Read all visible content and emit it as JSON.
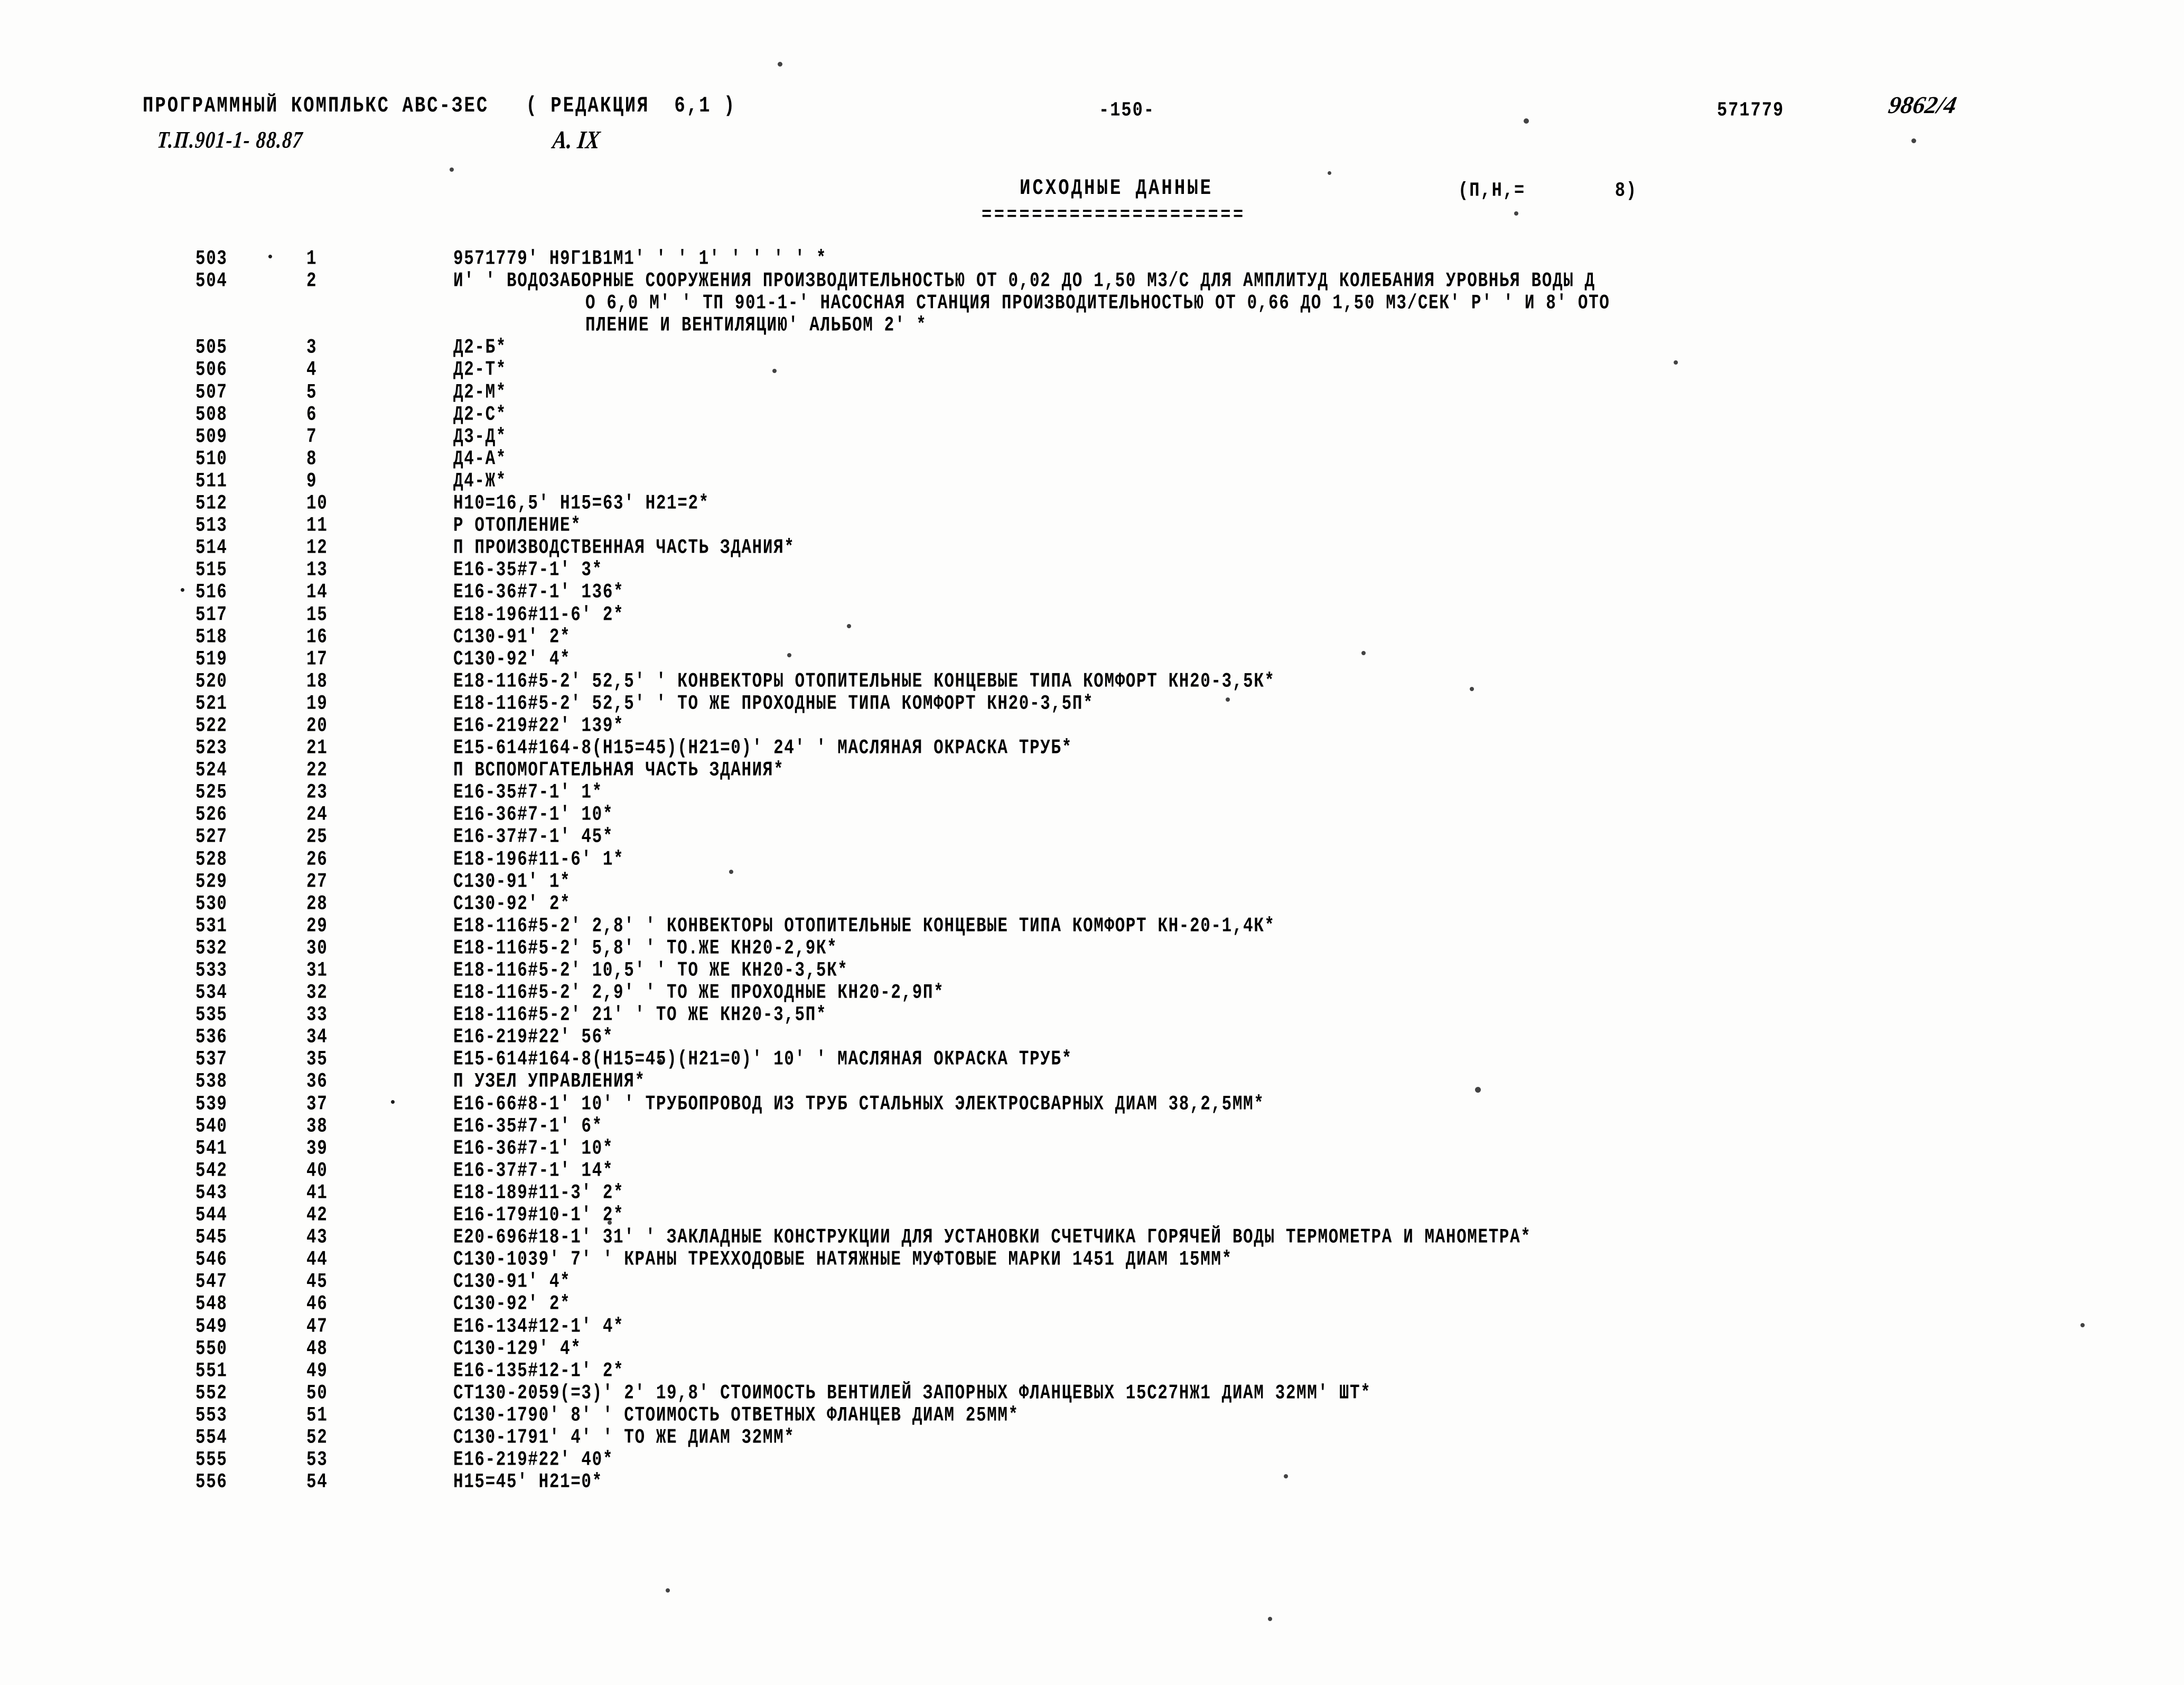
{
  "header": {
    "program_line": "ПРОГРАММНЫЙ КОМПЛЬКС АВС-ЗЕС   ( РЕДАКЦИЯ  6,1 )",
    "project_line": "Т.П.901-1- 88.87",
    "album_mark": "А. IX",
    "page_number": "-150-",
    "doc_code": "571779",
    "stamp": "9862/4"
  },
  "title": {
    "main": "ИСХОДНЫЕ ДАННЫЕ",
    "underline": "=====================",
    "param": "(П,Н,=        8)"
  },
  "listing": {
    "rows": [
      {
        "seq": "503",
        "num": "1",
        "text": "9571779' Н9Г1В1М1' ' ' 1' ' ' ' ' *",
        "dot_after_seq": true
      },
      {
        "seq": "504",
        "num": "2",
        "text": "И' ' ВОДОЗАБОРНЫЕ СООРУЖЕНИЯ ПРОИЗВОДИТЕЛЬНОСТЬЮ ОТ 0,02 ДО 1,50 М3/С ДЛЯ АМПЛИТУД КОЛЕБАНИЯ УРОВНЬЯ ВОДЫ Д"
      },
      {
        "seq": "",
        "num": "",
        "cont": "О 6,0 М' ' ТП 901-1-' НАСОСНАЯ СТАНЦИЯ ПРОИЗВОДИТЕЛЬНОСТЬЮ ОТ 0,66 ДО 1,50 М3/СЕК' Р' ' И 8' ОТО"
      },
      {
        "seq": "",
        "num": "",
        "cont": "ПЛЕНИЕ И ВЕНТИЛЯЦИЮ' АЛЬБОМ 2' *"
      },
      {
        "seq": "505",
        "num": "3",
        "text": "Д2-Б*"
      },
      {
        "seq": "506",
        "num": "4",
        "text": "Д2-Т*"
      },
      {
        "seq": "507",
        "num": "5",
        "text": "Д2-М*"
      },
      {
        "seq": "508",
        "num": "6",
        "text": "Д2-С*"
      },
      {
        "seq": "509",
        "num": "7",
        "text": "Д3-Д*"
      },
      {
        "seq": "510",
        "num": "8",
        "text": "Д4-А*"
      },
      {
        "seq": "511",
        "num": "9",
        "text": "Д4-Ж*"
      },
      {
        "seq": "512",
        "num": "10",
        "text": "Н10=16,5' Н15=63' Н21=2*"
      },
      {
        "seq": "513",
        "num": "11",
        "text": "Р ОТОПЛЕНИЕ*"
      },
      {
        "seq": "514",
        "num": "12",
        "text": "П ПРОИЗВОДСТВЕННАЯ ЧАСТЬ ЗДАНИЯ*"
      },
      {
        "seq": "515",
        "num": "13",
        "text": "Е16-35#7-1' 3*"
      },
      {
        "seq": "516",
        "num": "14",
        "text": "Е16-36#7-1' 136*",
        "dot_before_seq": true
      },
      {
        "seq": "517",
        "num": "15",
        "text": "Е18-196#11-6' 2*"
      },
      {
        "seq": "518",
        "num": "16",
        "text": "С130-91' 2*"
      },
      {
        "seq": "519",
        "num": "17",
        "text": "С130-92' 4*"
      },
      {
        "seq": "520",
        "num": "18",
        "text": "Е18-116#5-2' 52,5' ' КОНВЕКТОРЫ ОТОПИТЕЛЬНЫЕ КОНЦЕВЫЕ ТИПА КОМФОРТ КН20-3,5К*"
      },
      {
        "seq": "521",
        "num": "19",
        "text": "Е18-116#5-2' 52,5' ' ТО ЖЕ ПРОХОДНЫЕ ТИПА КОМФОРТ КН20-3,5П*"
      },
      {
        "seq": "522",
        "num": "20",
        "text": "Е16-219#22' 139*"
      },
      {
        "seq": "523",
        "num": "21",
        "text": "Е15-614#164-8(Н15=45)(Н21=0)' 24' ' МАСЛЯНАЯ ОКРАСКА ТРУБ*"
      },
      {
        "seq": "524",
        "num": "22",
        "text": "П ВСПОМОГАТЕЛЬНАЯ ЧАСТЬ ЗДАНИЯ*"
      },
      {
        "seq": "525",
        "num": "23",
        "text": "Е16-35#7-1' 1*"
      },
      {
        "seq": "526",
        "num": "24",
        "text": "Е16-36#7-1' 10*"
      },
      {
        "seq": "527",
        "num": "25",
        "text": "Е16-37#7-1' 45*"
      },
      {
        "seq": "528",
        "num": "26",
        "text": "Е18-196#11-6' 1*"
      },
      {
        "seq": "529",
        "num": "27",
        "text": "С130-91' 1*"
      },
      {
        "seq": "530",
        "num": "28",
        "text": "С130-92' 2*"
      },
      {
        "seq": "531",
        "num": "29",
        "text": "Е18-116#5-2' 2,8' ' КОНВЕКТОРЫ ОТОПИТЕЛЬНЫЕ КОНЦЕВЫЕ ТИПА КОМФОРТ КН-20-1,4К*"
      },
      {
        "seq": "532",
        "num": "30",
        "text": "Е18-116#5-2' 5,8' ' ТО.ЖЕ КН20-2,9К*"
      },
      {
        "seq": "533",
        "num": "31",
        "text": "Е18-116#5-2' 10,5' ' ТО ЖЕ КН20-3,5К*"
      },
      {
        "seq": "534",
        "num": "32",
        "text": "Е18-116#5-2' 2,9' ' ТО ЖЕ ПРОХОДНЫЕ КН20-2,9П*"
      },
      {
        "seq": "535",
        "num": "33",
        "text": "Е18-116#5-2' 21' ' ТО ЖЕ КН20-3,5П*"
      },
      {
        "seq": "536",
        "num": "34",
        "text": "Е16-219#22' 56*"
      },
      {
        "seq": "537",
        "num": "35",
        "text": "Е15-614#164-8(Н15=45)(Н21=0)' 10' ' МАСЛЯНАЯ ОКРАСКА ТРУБ*"
      },
      {
        "seq": "538",
        "num": "36",
        "text": "П УЗЕЛ УПРАВЛЕНИЯ*"
      },
      {
        "seq": "539",
        "num": "37",
        "text": "Е16-66#8-1' 10' ' ТРУБОПРОВОД ИЗ ТРУБ СТАЛЬНЫХ ЭЛЕКТРОСВАРНЫХ ДИАМ 38,2,5ММ*",
        "dot_after_num": true
      },
      {
        "seq": "540",
        "num": "38",
        "text": "Е16-35#7-1' 6*"
      },
      {
        "seq": "541",
        "num": "39",
        "text": "Е16-36#7-1' 10*"
      },
      {
        "seq": "542",
        "num": "40",
        "text": "Е16-37#7-1' 14*"
      },
      {
        "seq": "543",
        "num": "41",
        "text": "Е18-189#11-3' 2*"
      },
      {
        "seq": "544",
        "num": "42",
        "text": "Е16-179#10-1' 2*"
      },
      {
        "seq": "545",
        "num": "43",
        "text": "Е20-696#18-1' 31' ' ЗАКЛАДНЫЕ КОНСТРУКЦИИ ДЛЯ УСТАНОВКИ СЧЕТЧИКА ГОРЯЧЕЙ ВОДЫ ТЕРМОМЕТРА И МАНОМЕТРА*"
      },
      {
        "seq": "546",
        "num": "44",
        "text": "С130-1039' 7' ' КРАНЫ ТРЕХХОДОВЫЕ НАТЯЖНЫЕ МУФТОВЫЕ МАРКИ 1451 ДИАМ 15ММ*"
      },
      {
        "seq": "547",
        "num": "45",
        "text": "С130-91' 4*"
      },
      {
        "seq": "548",
        "num": "46",
        "text": "С130-92' 2*"
      },
      {
        "seq": "549",
        "num": "47",
        "text": "Е16-134#12-1' 4*"
      },
      {
        "seq": "550",
        "num": "48",
        "text": "С130-129' 4*"
      },
      {
        "seq": "551",
        "num": "49",
        "text": "Е16-135#12-1' 2*"
      },
      {
        "seq": "552",
        "num": "50",
        "text": "СТ130-2059(=3)' 2' 19,8' СТОИМОСТЬ ВЕНТИЛЕЙ ЗАПОРНЫХ ФЛАНЦЕВЫХ 15С27НЖ1 ДИАМ 32ММ' ШТ*"
      },
      {
        "seq": "553",
        "num": "51",
        "text": "С130-1790' 8' ' СТОИМОСТЬ ОТВЕТНЫХ ФЛАНЦЕВ ДИАМ 25ММ*"
      },
      {
        "seq": "554",
        "num": "52",
        "text": "С130-1791' 4' ' ТО ЖЕ ДИАМ 32ММ*"
      },
      {
        "seq": "555",
        "num": "53",
        "text": "Е16-219#22' 40*"
      },
      {
        "seq": "556",
        "num": "54",
        "text": "Н15=45' Н21=0*"
      }
    ]
  }
}
